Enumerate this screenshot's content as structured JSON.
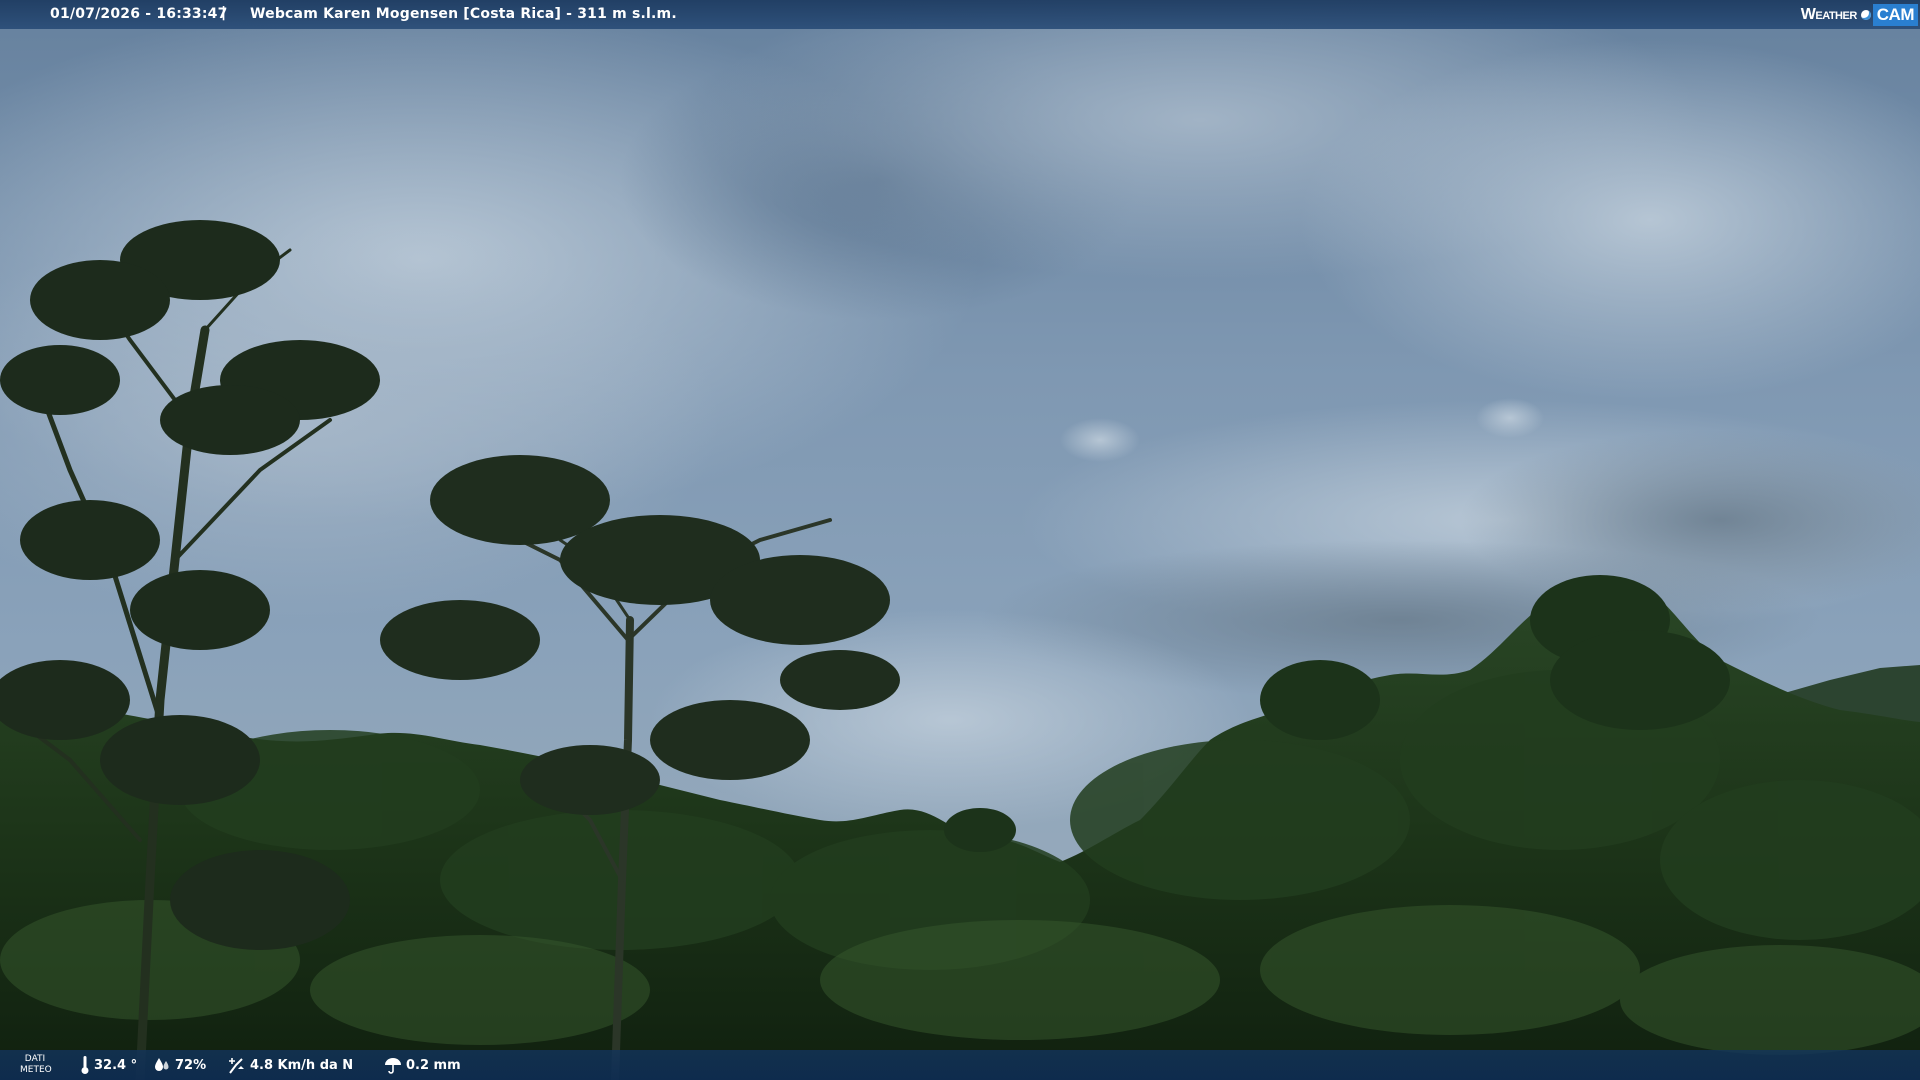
{
  "overlay": {
    "timestamp": "01/07/2026 - 16:33:47",
    "separator": "|",
    "camera_title": "Webcam Karen Mogensen [Costa Rica] - 311 m s.l.m.",
    "logo": {
      "part1": "Weather",
      "part2": "CAM",
      "icon": "globe-icon"
    }
  },
  "weather_bar": {
    "label_line1": "DATI",
    "label_line2": "METEO",
    "temperature": {
      "icon": "thermometer-icon",
      "value": "32.4 °"
    },
    "humidity": {
      "icon": "droplets-icon",
      "value": "72%"
    },
    "wind": {
      "icon": "wind-vane-icon",
      "value": "4.8 Km/h da N"
    },
    "rain": {
      "icon": "umbrella-icon",
      "value": "0.2 mm"
    }
  },
  "colors": {
    "bar_blue": "#1c3a60",
    "logo_cam_blue": "#2a7fd0",
    "sky_top": "#6f8aa6",
    "sky_bright": "#a9bccd",
    "forest_dark": "#0f1f10",
    "forest_mid": "#2b4a25"
  }
}
